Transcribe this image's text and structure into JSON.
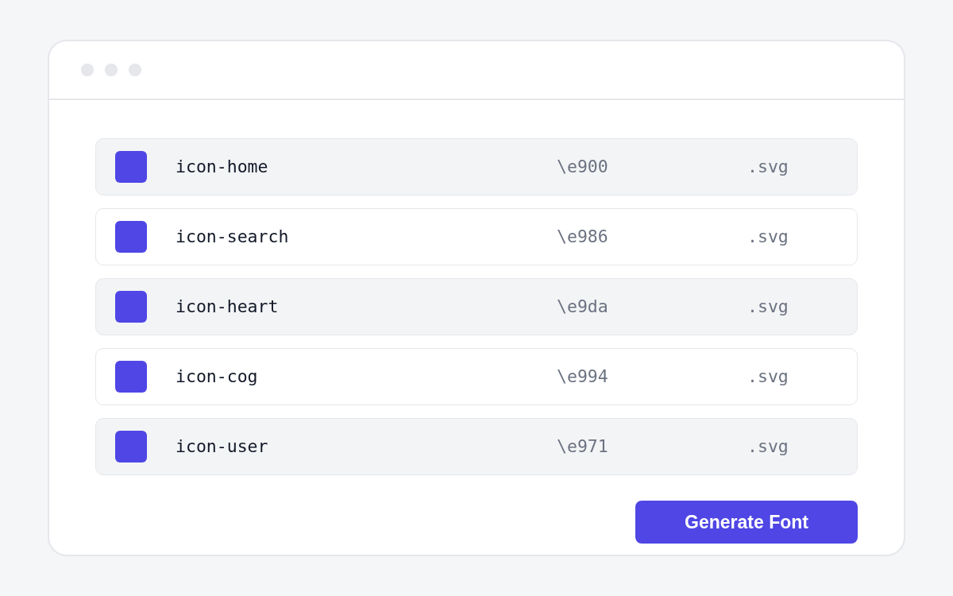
{
  "glyphs": [
    {
      "name": "icon-home",
      "code": "\\e900",
      "extension": ".svg"
    },
    {
      "name": "icon-search",
      "code": "\\e986",
      "extension": ".svg"
    },
    {
      "name": "icon-heart",
      "code": "\\e9da",
      "extension": ".svg"
    },
    {
      "name": "icon-cog",
      "code": "\\e994",
      "extension": ".svg"
    },
    {
      "name": "icon-user",
      "code": "\\e971",
      "extension": ".svg"
    }
  ],
  "generate_button": {
    "label": "Generate Font"
  }
}
